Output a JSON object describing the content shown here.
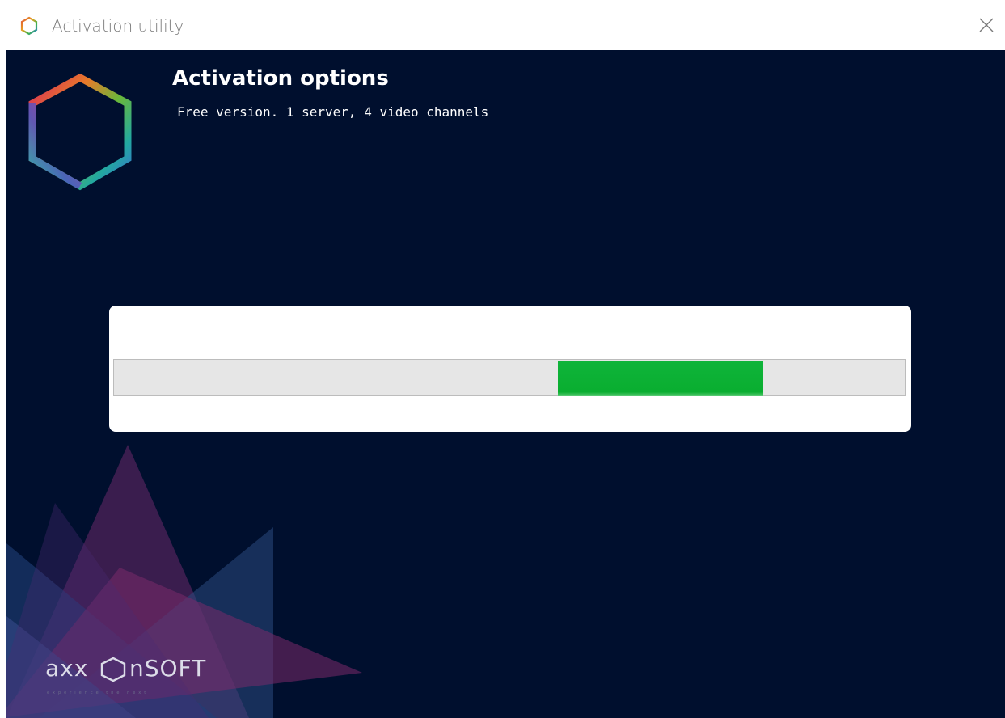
{
  "window": {
    "title": "Activation utility",
    "close_icon": "close-icon",
    "app_icon": "hexagon-logo-icon"
  },
  "main": {
    "heading": "Activation options",
    "subheading": "Free version. 1 server, 4 video channels"
  },
  "progress": {
    "state": "indeterminate",
    "fill_color": "#0fb43a"
  },
  "brand": {
    "name": "axxonsoft",
    "tagline": "experience the next"
  },
  "colors": {
    "background": "#000f2e",
    "card": "#ffffff",
    "track": "#e6e6e6",
    "accent_green": "#0fb43a"
  }
}
